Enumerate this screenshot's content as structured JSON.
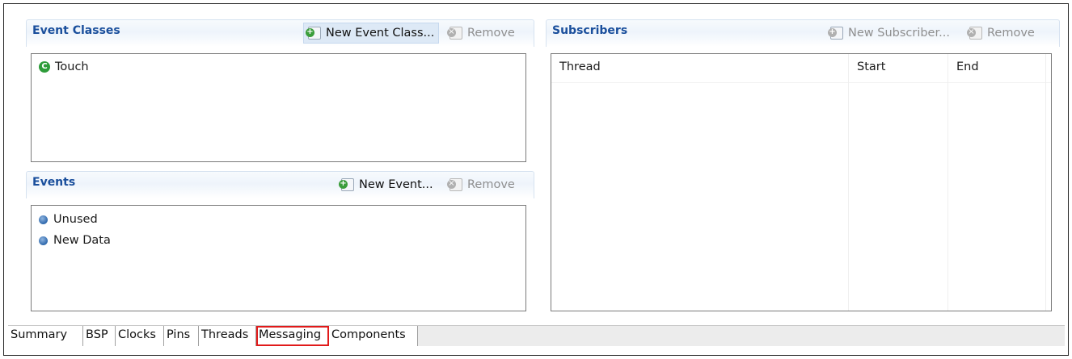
{
  "event_classes": {
    "title": "Event Classes",
    "new_label": "New Event Class...",
    "remove_label": "Remove",
    "items": [
      {
        "label": "Touch",
        "icon": "class-c-icon"
      }
    ]
  },
  "events": {
    "title": "Events",
    "new_label": "New Event...",
    "remove_label": "Remove",
    "items": [
      {
        "label": "Unused",
        "icon": "blue-dot-icon"
      },
      {
        "label": "New Data",
        "icon": "blue-dot-icon"
      }
    ]
  },
  "subscribers": {
    "title": "Subscribers",
    "new_label": "New Subscriber...",
    "remove_label": "Remove",
    "columns": [
      "Thread",
      "Start",
      "End"
    ],
    "rows": []
  },
  "tabs": [
    "Summary",
    "BSP",
    "Clocks",
    "Pins",
    "Threads",
    "Messaging",
    "Components"
  ],
  "active_tab": "Messaging",
  "colors": {
    "section_title": "#1a4f9c",
    "active_tab_outline": "#e11a1a",
    "class_icon": "#2e9c3a",
    "event_icon": "#2f68ac"
  }
}
